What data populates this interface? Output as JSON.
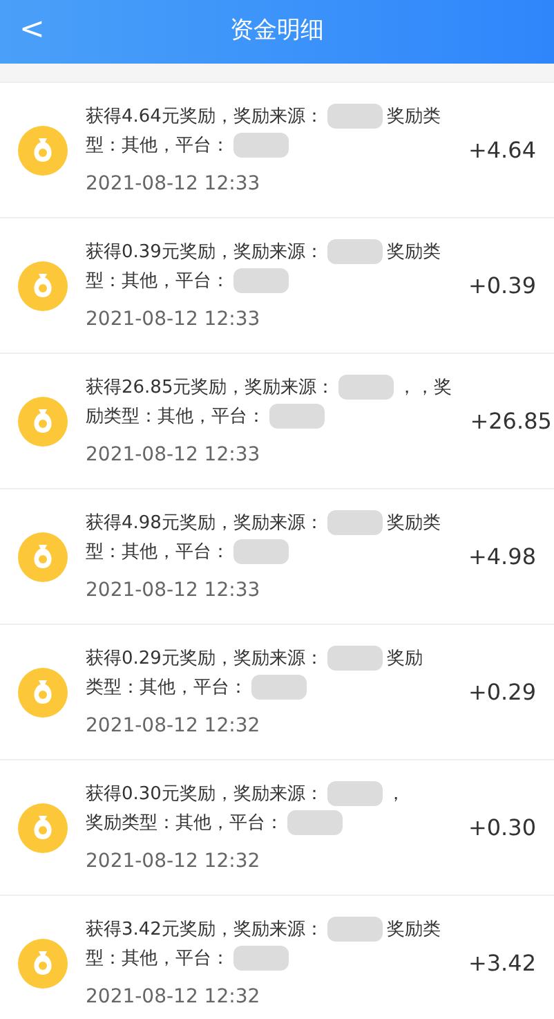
{
  "header": {
    "back": "<",
    "title": "资金明细"
  },
  "records": [
    {
      "lines": [
        [
          {
            "kind": "text",
            "text": "获得4.64元奖励，奖励来源："
          },
          {
            "kind": "blur"
          },
          {
            "kind": "text",
            "text": "奖励类"
          }
        ],
        [
          {
            "kind": "text",
            "text": "型：其他，平台："
          },
          {
            "kind": "blur"
          }
        ]
      ],
      "time": "2021-08-12 12:33",
      "amount": "+4.64"
    },
    {
      "lines": [
        [
          {
            "kind": "text",
            "text": "获得0.39元奖励，奖励来源："
          },
          {
            "kind": "blur"
          },
          {
            "kind": "text",
            "text": "奖励类"
          }
        ],
        [
          {
            "kind": "text",
            "text": "型：其他，平台："
          },
          {
            "kind": "blur"
          }
        ]
      ],
      "time": "2021-08-12 12:33",
      "amount": "+0.39"
    },
    {
      "lines": [
        [
          {
            "kind": "text",
            "text": "获得26.85元奖励，奖励来源："
          },
          {
            "kind": "blur"
          },
          {
            "kind": "text",
            "text": "，，奖"
          }
        ],
        [
          {
            "kind": "text",
            "text": "励类型：其他，平台："
          },
          {
            "kind": "blur"
          }
        ]
      ],
      "time": "2021-08-12 12:33",
      "amount": "+26.85"
    },
    {
      "lines": [
        [
          {
            "kind": "text",
            "text": "获得4.98元奖励，奖励来源："
          },
          {
            "kind": "blur"
          },
          {
            "kind": "text",
            "text": "奖励类"
          }
        ],
        [
          {
            "kind": "text",
            "text": "型：其他，平台："
          },
          {
            "kind": "blur"
          }
        ]
      ],
      "time": "2021-08-12 12:33",
      "amount": "+4.98"
    },
    {
      "lines": [
        [
          {
            "kind": "text",
            "text": "获得0.29元奖励，奖励来源："
          },
          {
            "kind": "blur"
          },
          {
            "kind": "text",
            "text": "奖励"
          }
        ],
        [
          {
            "kind": "text",
            "text": "类型：其他，平台："
          },
          {
            "kind": "blur"
          }
        ]
      ],
      "time": "2021-08-12 12:32",
      "amount": "+0.29"
    },
    {
      "lines": [
        [
          {
            "kind": "text",
            "text": "获得0.30元奖励，奖励来源："
          },
          {
            "kind": "blur"
          },
          {
            "kind": "text",
            "text": "，"
          }
        ],
        [
          {
            "kind": "text",
            "text": "奖励类型：其他，平台："
          },
          {
            "kind": "blur"
          }
        ]
      ],
      "time": "2021-08-12 12:32",
      "amount": "+0.30"
    },
    {
      "lines": [
        [
          {
            "kind": "text",
            "text": "获得3.42元奖励，奖励来源："
          },
          {
            "kind": "blur"
          },
          {
            "kind": "text",
            "text": "奖励类"
          }
        ],
        [
          {
            "kind": "text",
            "text": "型：其他，平台："
          },
          {
            "kind": "blur"
          }
        ]
      ],
      "time": "2021-08-12 12:32",
      "amount": "+3.42"
    }
  ]
}
